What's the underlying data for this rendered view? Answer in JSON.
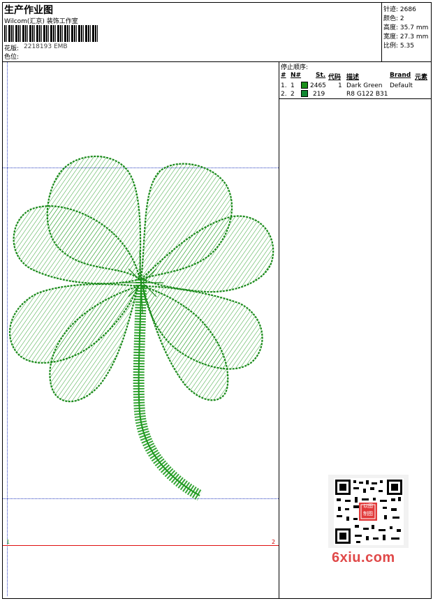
{
  "header": {
    "title": "生产作业图",
    "company": "Wilcom(汇京) 装饰工作室",
    "design_label": "花版:",
    "design_value": "2218193 EMB",
    "color_label": "色位:"
  },
  "stats": [
    {
      "label": "针迹:",
      "value": "2686"
    },
    {
      "label": "颜色:",
      "value": "2"
    },
    {
      "label": "高度:",
      "value": "35.7 mm"
    },
    {
      "label": "宽度:",
      "value": "27.3 mm"
    },
    {
      "label": "比例:",
      "value": "5.35"
    }
  ],
  "stop_sequence": {
    "title": "停止顺序:",
    "columns": [
      "#",
      "N#",
      "St.",
      "代码",
      "描述",
      "Brand",
      "元素"
    ],
    "rows": [
      {
        "num": "1.",
        "n": "1",
        "color": "#1a8f1a",
        "stitches": "2465",
        "code": "1",
        "desc": "Dark Green",
        "brand": "Default",
        "elem": ""
      },
      {
        "num": "2.",
        "n": "2",
        "color": "#118833",
        "stitches": "219",
        "code": "",
        "desc": "R8 G122 B31",
        "brand": "",
        "elem": ""
      }
    ]
  },
  "canvas": {
    "stop_marker_start": "1",
    "stop_marker_end": "2",
    "thread_color": "#1f9a1f"
  },
  "watermark": {
    "site": "6xiu.com",
    "seal_text": "以图\n制图"
  }
}
